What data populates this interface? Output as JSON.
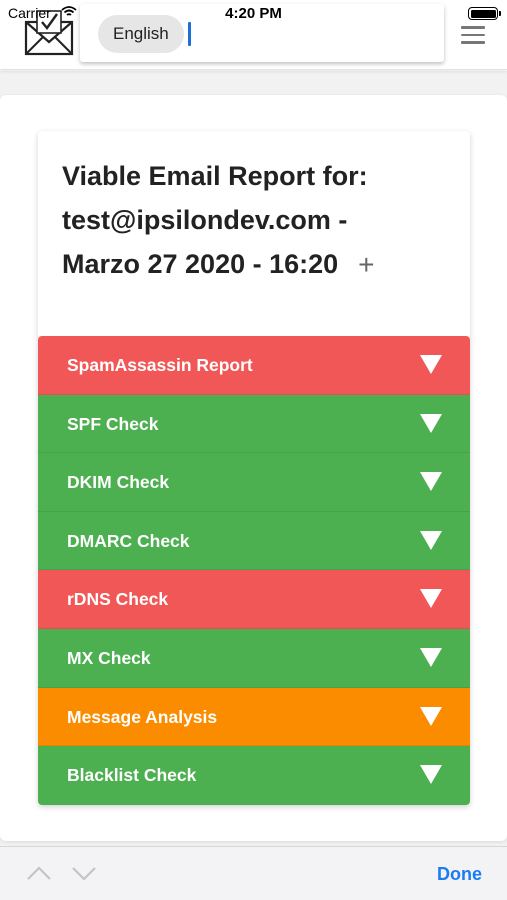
{
  "status_bar": {
    "carrier": "Carrier",
    "time": "4:20 PM"
  },
  "header": {
    "language": "English",
    "logo_icon": "envelope-check-icon",
    "menu_icon": "hamburger-menu-icon"
  },
  "report": {
    "title_line1": "Viable Email Report for:",
    "title_line2": "test@ipsilondev.com -",
    "title_line3": "Marzo 27 2020 - 16:20",
    "expand_icon": "plus"
  },
  "sections": [
    {
      "label": "SpamAssassin Report",
      "status": "fail",
      "color": "#f25757"
    },
    {
      "label": "SPF Check",
      "status": "pass",
      "color": "#4caf50"
    },
    {
      "label": "DKIM Check",
      "status": "pass",
      "color": "#4caf50"
    },
    {
      "label": "DMARC Check",
      "status": "pass",
      "color": "#4caf50"
    },
    {
      "label": "rDNS Check",
      "status": "fail",
      "color": "#f25757"
    },
    {
      "label": "MX Check",
      "status": "pass",
      "color": "#4caf50"
    },
    {
      "label": "Message Analysis",
      "status": "warning",
      "color": "#fb8c00"
    },
    {
      "label": "Blacklist Check",
      "status": "pass",
      "color": "#4caf50"
    }
  ],
  "keyboard_toolbar": {
    "done_label": "Done"
  }
}
